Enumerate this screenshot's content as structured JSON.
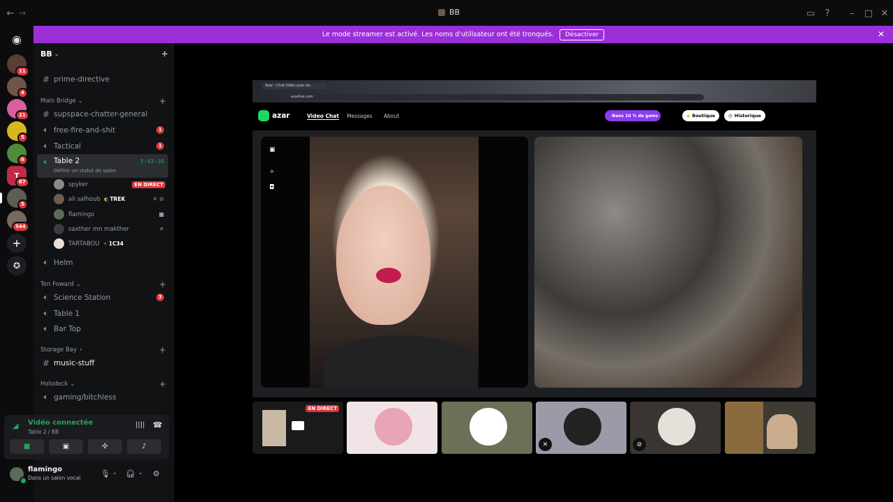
{
  "window": {
    "title": "BB"
  },
  "banner": {
    "message": "Le mode streamer est activé. Les noms d'utilisateur ont été tronqués.",
    "disable_label": "Désactiver"
  },
  "guilds": [
    {
      "badge": "11"
    },
    {
      "badge": "4"
    },
    {
      "badge": "21"
    },
    {
      "badge": "5"
    },
    {
      "badge": "6"
    },
    {
      "badge": "67"
    },
    {
      "badge": "5"
    },
    {
      "badge": "544"
    }
  ],
  "server": {
    "name": "BB"
  },
  "channels": {
    "prime_directive": "prime-directive",
    "cat_main_bridge": "Main Bridge",
    "supspace": "supspace-chatter-general",
    "free_fire": {
      "label": "free-fire-and-shit",
      "badge": "1"
    },
    "tactical": {
      "label": "Tactical",
      "badge": "1"
    },
    "table2": {
      "label": "Table 2",
      "timer": "5:43:10",
      "status": "Définir un statut de salon"
    },
    "helm": "Helm",
    "cat_ten_foward": "Ten Foward",
    "science": {
      "label": "Science Station",
      "badge": "3"
    },
    "table1": "Table 1",
    "bartop": "Bar Top",
    "cat_storage": "Storage Bay",
    "music": "music-stuff",
    "cat_holodeck": "Holodeck",
    "gaming": "gaming/bitchless"
  },
  "voice_users": [
    {
      "name": "spyker",
      "live": "EN DIRECT"
    },
    {
      "name": "ali salhoub",
      "tag": "TREK"
    },
    {
      "name": "flamingo"
    },
    {
      "name": "saxther mn makther"
    },
    {
      "name": "TARTABOU",
      "tag": "1C34"
    }
  ],
  "voice_panel": {
    "title": "Vidéo connectée",
    "subtitle": "Table 2 / BB"
  },
  "user_panel": {
    "name": "flamingo",
    "status": "Dans un salon vocal"
  },
  "browser": {
    "tab": "Azar : Chat Vidéo avec de",
    "url": "azarlive.com"
  },
  "azar": {
    "brand": "azar",
    "nav": [
      "Video Chat",
      "Messages",
      "About"
    ],
    "promo": "-Bens 10 % de gems",
    "boutique": "Boutique",
    "historique": "Historique"
  },
  "tiles": [
    {
      "live": "EN DIRECT"
    }
  ],
  "colors": {
    "accent": "#9b2fd8",
    "live": "#da373c",
    "connected": "#23a55a",
    "azar_green": "#1ed760"
  }
}
